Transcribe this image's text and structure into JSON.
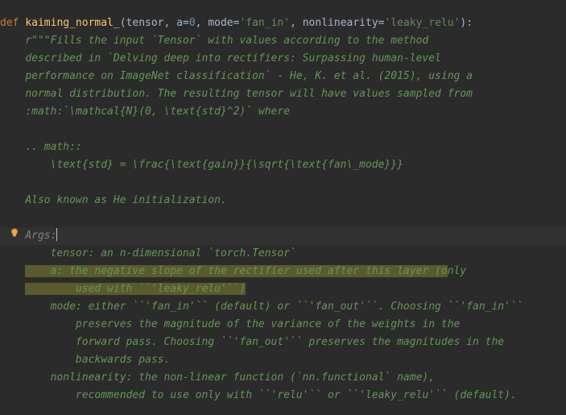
{
  "code": {
    "def_kw": "def",
    "fn_name": "kaiming_normal_",
    "params": {
      "p1": "tensor",
      "p2": "a",
      "p2_default": "0",
      "p3": "mode",
      "p3_default": "'fan_in'",
      "p4": "nonlinearity",
      "p4_default": "'leaky_relu'"
    },
    "doc": {
      "l1": "r\"\"\"Fills the input `Tensor` with values according to the method",
      "l2": "described in `Delving deep into rectifiers: Surpassing human-level",
      "l3": "performance on ImageNet classification` - He, K. et al. (2015), using a",
      "l4": "normal distribution. The resulting tensor will have values sampled from",
      "l5": ":math:`\\mathcal{N}(0, \\text{std}^2)` where",
      "l6": ".. math::",
      "l7": "    \\text{std} = \\frac{\\text{gain}}{\\sqrt{\\text{fan\\_mode}}}",
      "l8": "Also known as He initialization.",
      "args_label": "Args:",
      "a_tensor": "    tensor: an n-dimensional `torch.Tensor`",
      "a_a1": "    a: the negative slope of the rectifier used after this layer (o",
      "a_a1_tail": "nly",
      "a_a2": "        used with ``'leaky_relu'``)",
      "a_mode1": "    mode: either ``'fan_in'`` (default) or ``'fan_out'``. Choosing ``'fan_in'``",
      "a_mode2": "        preserves the magnitude of the variance of the weights in the",
      "a_mode3": "        forward pass. Choosing ``'fan_out'`` preserves the magnitudes in the",
      "a_mode4": "        backwards pass.",
      "a_nl1": "    nonlinearity: the non-linear function (`nn.functional` name),",
      "a_nl2": "        recommended to use only with ``'relu'`` or ``'leaky_relu'`` (default)."
    }
  },
  "icons": {
    "bulb": "lightbulb-icon"
  },
  "colors": {
    "bg": "#2b2b2b",
    "keyword": "#cc7832",
    "function": "#ffc66d",
    "string": "#6a8759",
    "number": "#6897bb",
    "docstring": "#629755",
    "selection": "#5b5a2d"
  },
  "lineno_visible": "0"
}
